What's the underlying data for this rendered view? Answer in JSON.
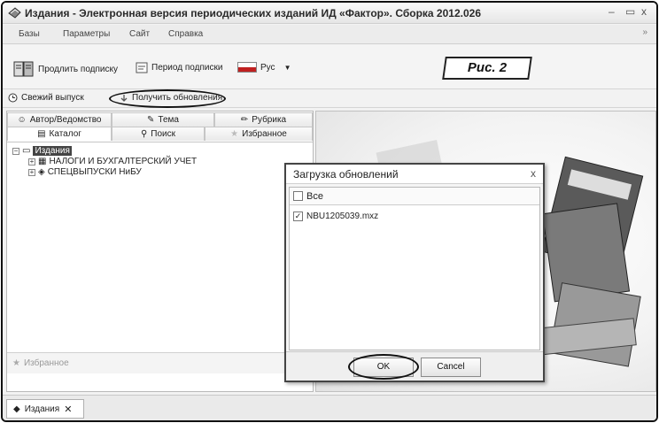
{
  "window": {
    "title": "Издания - Электронная версия периодических изданий ИД «Фактор». Сборка 2012.026",
    "minimize": "–",
    "maximize": "▭",
    "close": "x"
  },
  "menu": [
    "Базы",
    "Параметры",
    "Сайт",
    "Справка"
  ],
  "menu_chevron": "»",
  "toolbar": {
    "extend_subscription": "Продлить подписку",
    "subscription_period": "Период подписки",
    "language": "Рус",
    "caption": "Рис. 2"
  },
  "toolbar2": {
    "fresh_issue": "Свежий выпуск",
    "get_updates": "Получить обновления"
  },
  "tabs_top": [
    "Автор/Ведомство",
    "Тема",
    "Рубрика"
  ],
  "tabs_bottom": [
    "Каталог",
    "Поиск",
    "Избранное"
  ],
  "tree": {
    "root": "Издания",
    "children": [
      "НАЛОГИ И БУХГАЛТЕРСКИЙ УЧЕТ",
      "СПЕЦВЫПУСКИ НиБУ"
    ]
  },
  "favorites_label": "Избранное",
  "bottom_tab": "Издания",
  "dialog": {
    "title": "Загрузка обновлений",
    "close": "x",
    "select_all": "Все",
    "files": [
      "NBU1205039.mxz"
    ],
    "ok": "OK",
    "cancel": "Cancel"
  },
  "colors": {
    "selection": "#444444",
    "flag_red": "#c02020"
  }
}
